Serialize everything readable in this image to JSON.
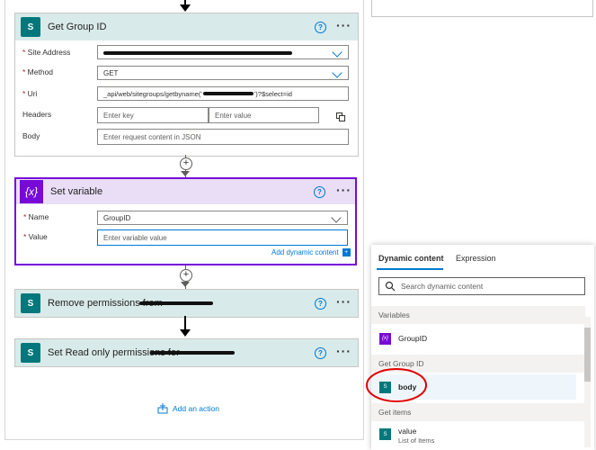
{
  "get_group_id": {
    "title": "Get Group ID",
    "fields": {
      "site_address_label": "Site Address",
      "method_label": "Method",
      "method_value": "GET",
      "uri_label": "Uri",
      "uri_prefix": "_api/web/sitegroups/getbyname('",
      "uri_suffix": "')?$select=id",
      "headers_label": "Headers",
      "headers_key_placeholder": "Enter key",
      "headers_value_placeholder": "Enter value",
      "body_label": "Body",
      "body_placeholder": "Enter request content in JSON"
    }
  },
  "set_variable": {
    "title": "Set variable",
    "icon_text": "{x}",
    "name_label": "Name",
    "name_value": "GroupID",
    "value_label": "Value",
    "value_placeholder": "Enter variable value",
    "add_dynamic": "Add dynamic content"
  },
  "remove_permissions": {
    "title": "Remove permissions from"
  },
  "read_only": {
    "title": "Set Read only permissions for"
  },
  "add_action": "Add an action",
  "dynamic_panel": {
    "tabs": [
      "Dynamic content",
      "Expression"
    ],
    "search_placeholder": "Search dynamic content",
    "sections": [
      {
        "header": "Variables",
        "items": [
          {
            "label": "GroupID",
            "sub": ""
          }
        ]
      },
      {
        "header": "Get Group ID",
        "items": [
          {
            "label": "body",
            "sub": ""
          }
        ]
      },
      {
        "header": "Get items",
        "items": [
          {
            "label": "value",
            "sub": "List of Items"
          }
        ]
      }
    ]
  },
  "colors": {
    "sharepoint_teal": "#03787c",
    "variable_purple": "#770bd6",
    "accent_blue": "#0078d4",
    "highlight_red": "#e00000"
  }
}
